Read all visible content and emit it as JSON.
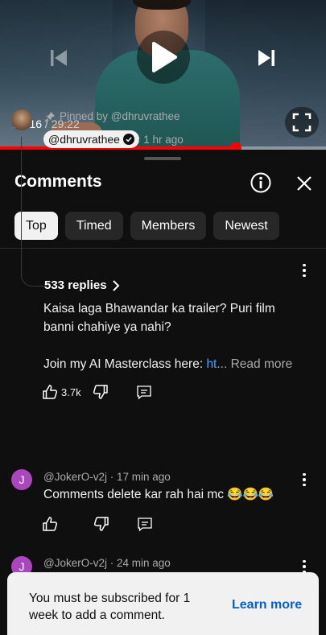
{
  "player": {
    "current_time": "21:16",
    "separator": " / ",
    "duration": "29:22",
    "progress": 0.724
  },
  "sheet": {
    "title": "Comments"
  },
  "chips": [
    {
      "label": "Top",
      "active": true
    },
    {
      "label": "Timed",
      "active": false
    },
    {
      "label": "Members",
      "active": false
    },
    {
      "label": "Newest",
      "active": false
    }
  ],
  "comments": [
    {
      "pinned_label": "Pinned by @dhruvrathee",
      "author": "@dhruvrathee",
      "time": "· 1 hr ago",
      "line1": "Kaisa laga Bhawandar ka trailer? Puri film",
      "line2": "banni chahiye ya nahi?",
      "line3": "Join my AI Masterclass here: ",
      "link": "ht",
      "read_more": "... Read more",
      "likes": "3.7k",
      "replies": "533 replies"
    },
    {
      "avatar_letter": "J",
      "author_time": "@JokerO-v2j · 17 min ago",
      "text": "Comments delete kar rah hai mc 😂😂😂"
    },
    {
      "avatar_letter": "J",
      "author_time": "@JokerO-v2j · 24 min ago"
    }
  ],
  "snackbar": {
    "message": "You must be subscribed for 1 week to add a comment.",
    "action": "Learn more"
  },
  "icons": [
    "previous-icon",
    "play-icon",
    "next-icon",
    "fullscreen-icon",
    "info-icon",
    "close-icon",
    "pin-icon",
    "verified-icon",
    "thumbs-up-icon",
    "thumbs-down-icon",
    "reply-icon",
    "more-vert-icon",
    "chevron-right-icon"
  ],
  "colors": {
    "accent_red": "#ff0000",
    "link_blue": "#3ea6ff",
    "avatar_purple": "#ab47bc",
    "learn_more_blue": "#065fd4"
  }
}
